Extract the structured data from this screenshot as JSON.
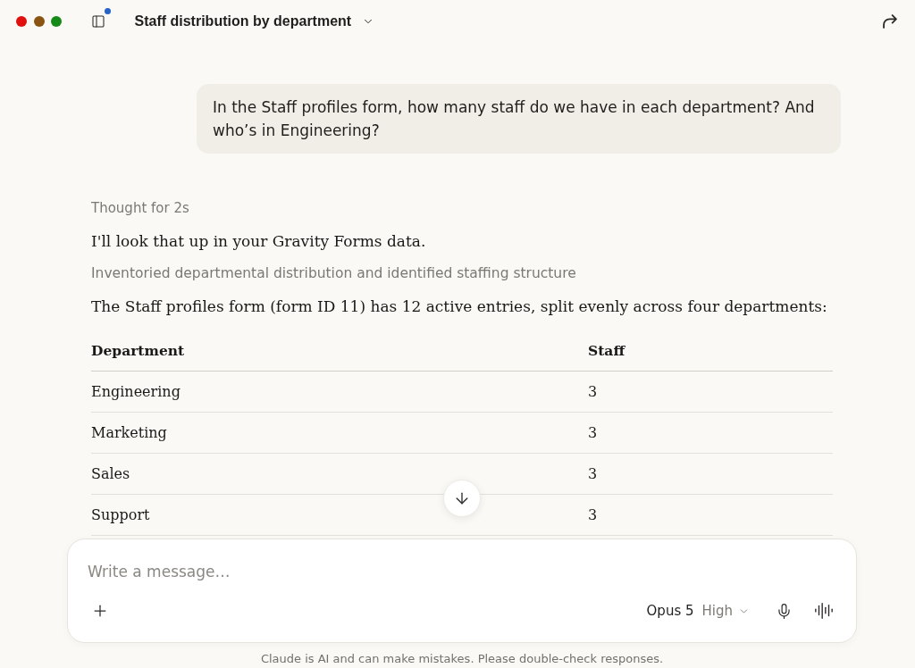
{
  "window": {
    "title": "Staff distribution by department",
    "sidebar_notification": true
  },
  "conversation": {
    "user_message": "In the Staff profiles form, how many staff do we have in each department? And who’s in Engineering?",
    "thought": "Thought for 2s",
    "reply_intro": "I'll look that up in your Gravity Forms data.",
    "step_summary": "Inventoried departmental distribution and identified staffing structure",
    "answer": "The Staff profiles form (form ID 11) has 12 active entries, split evenly across four departments:",
    "table": {
      "columns": [
        "Department",
        "Staff"
      ],
      "rows": [
        [
          "Engineering",
          "3"
        ],
        [
          "Marketing",
          "3"
        ],
        [
          "Sales",
          "3"
        ],
        [
          "Support",
          "3"
        ]
      ]
    }
  },
  "composer": {
    "placeholder": "Write a message…",
    "model": "Opus 5",
    "effort": "High"
  },
  "disclaimer": "Claude is AI and can make mistakes. Please double-check responses."
}
